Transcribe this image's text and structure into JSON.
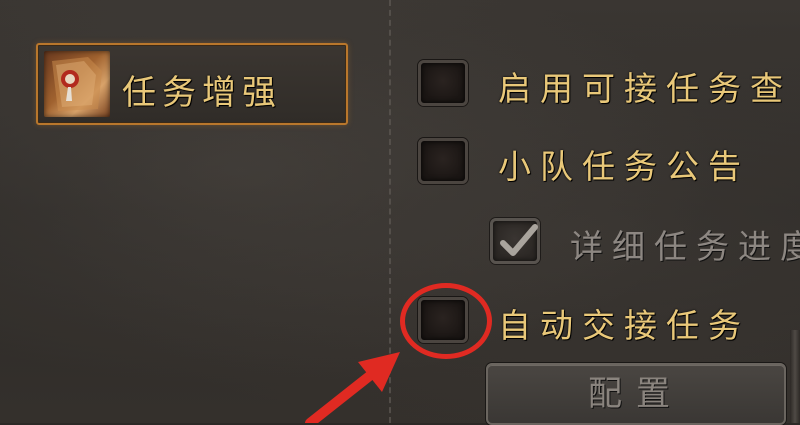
{
  "category": {
    "label": "任务增强",
    "icon": "quest-scroll-icon"
  },
  "options": [
    {
      "label": "启用可接任务查",
      "checked": false
    },
    {
      "label": "小队任务公告",
      "checked": false
    },
    {
      "label": "详细任务进度",
      "checked": true,
      "disabled": true
    },
    {
      "label": "自动交接任务",
      "checked": false,
      "highlighted": true
    }
  ],
  "config_button": {
    "label": "配置"
  },
  "colors": {
    "label_gold": "#e9c879",
    "highlight_red": "#e02a22",
    "category_border": "#b9772c",
    "disabled_text": "#8d8782"
  }
}
